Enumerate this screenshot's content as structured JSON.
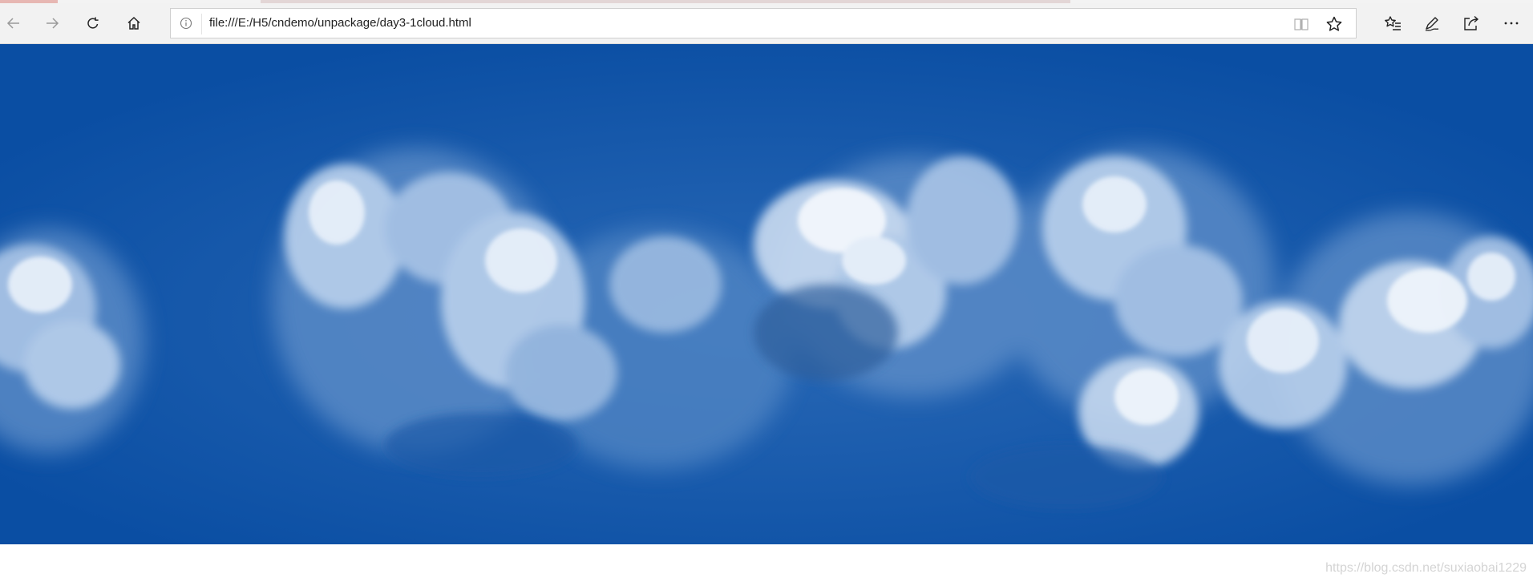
{
  "browser": {
    "url": "file:///E:/H5/cndemo/unpackage/day3-1cloud.html",
    "icons": {
      "back": "back-arrow-icon",
      "forward": "forward-arrow-icon",
      "refresh": "refresh-icon",
      "home": "home-icon",
      "site_info": "info-icon",
      "reading_view": "reading-view-icon",
      "favorite": "star-icon",
      "favorites_hub": "favorites-list-icon",
      "notes": "pen-icon",
      "share": "share-icon",
      "more": "more-dots-icon"
    }
  },
  "page": {
    "image": "cloud-sky-panorama",
    "sky_color": "#0a4ea3",
    "watermark": "https://blog.csdn.net/suxiaobai1229"
  }
}
